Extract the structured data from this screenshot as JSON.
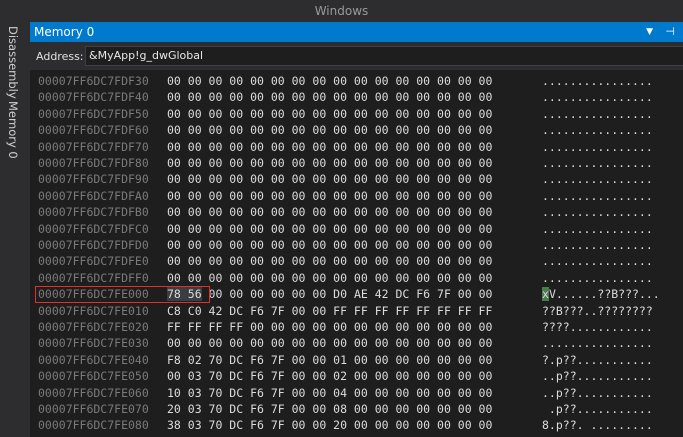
{
  "window": {
    "title": "Windows"
  },
  "rail": {
    "disassembly_tab": "Disassembly",
    "memory_tab": "Memory 0"
  },
  "panel": {
    "title": "Memory 0"
  },
  "address": {
    "label": "Address:",
    "value": "&MyApp!g_dwGlobal"
  },
  "colors": {
    "accent": "#007acc",
    "highlight": "#e0302a"
  },
  "rows": [
    {
      "addr": "00007FF6DC7FDF30",
      "bytes": "00 00 00 00 00 00 00 00 00 00 00 00 00 00 00 00",
      "ascii": "................"
    },
    {
      "addr": "00007FF6DC7FDF40",
      "bytes": "00 00 00 00 00 00 00 00 00 00 00 00 00 00 00 00",
      "ascii": "................"
    },
    {
      "addr": "00007FF6DC7FDF50",
      "bytes": "00 00 00 00 00 00 00 00 00 00 00 00 00 00 00 00",
      "ascii": "................"
    },
    {
      "addr": "00007FF6DC7FDF60",
      "bytes": "00 00 00 00 00 00 00 00 00 00 00 00 00 00 00 00",
      "ascii": "................"
    },
    {
      "addr": "00007FF6DC7FDF70",
      "bytes": "00 00 00 00 00 00 00 00 00 00 00 00 00 00 00 00",
      "ascii": "................"
    },
    {
      "addr": "00007FF6DC7FDF80",
      "bytes": "00 00 00 00 00 00 00 00 00 00 00 00 00 00 00 00",
      "ascii": "................"
    },
    {
      "addr": "00007FF6DC7FDF90",
      "bytes": "00 00 00 00 00 00 00 00 00 00 00 00 00 00 00 00",
      "ascii": "................"
    },
    {
      "addr": "00007FF6DC7FDFA0",
      "bytes": "00 00 00 00 00 00 00 00 00 00 00 00 00 00 00 00",
      "ascii": "................"
    },
    {
      "addr": "00007FF6DC7FDFB0",
      "bytes": "00 00 00 00 00 00 00 00 00 00 00 00 00 00 00 00",
      "ascii": "................"
    },
    {
      "addr": "00007FF6DC7FDFC0",
      "bytes": "00 00 00 00 00 00 00 00 00 00 00 00 00 00 00 00",
      "ascii": "................"
    },
    {
      "addr": "00007FF6DC7FDFD0",
      "bytes": "00 00 00 00 00 00 00 00 00 00 00 00 00 00 00 00",
      "ascii": "................"
    },
    {
      "addr": "00007FF6DC7FDFE0",
      "bytes": "00 00 00 00 00 00 00 00 00 00 00 00 00 00 00 00",
      "ascii": "................"
    },
    {
      "addr": "00007FF6DC7FDFF0",
      "bytes": "00 00 00 00 00 00 00 00 00 00 00 00 00 00 00 00",
      "ascii": "................"
    },
    {
      "addr": "00007FF6DC7FE000",
      "bytes_sel": "78 56",
      "bytes": "00 00 00 00 00 00 D0 AE 42 DC F6 7F 00 00",
      "ascii_sel": "x",
      "ascii": "V......??B???..."
    },
    {
      "addr": "00007FF6DC7FE010",
      "bytes": "C8 C0 42 DC F6 7F 00 00 FF FF FF FF FF FF FF FF",
      "ascii": "??B???..????????"
    },
    {
      "addr": "00007FF6DC7FE020",
      "bytes": "FF FF FF FF 00 00 00 00 00 00 00 00 00 00 00 00",
      "ascii": "????............"
    },
    {
      "addr": "00007FF6DC7FE030",
      "bytes": "00 00 00 00 00 00 00 00 00 00 00 00 00 00 00 00",
      "ascii": "................"
    },
    {
      "addr": "00007FF6DC7FE040",
      "bytes": "F8 02 70 DC F6 7F 00 00 01 00 00 00 00 00 00 00",
      "ascii": "?.p??..........."
    },
    {
      "addr": "00007FF6DC7FE050",
      "bytes": "00 03 70 DC F6 7F 00 00 02 00 00 00 00 00 00 00",
      "ascii": "..p??..........."
    },
    {
      "addr": "00007FF6DC7FE060",
      "bytes": "10 03 70 DC F6 7F 00 00 04 00 00 00 00 00 00 00",
      "ascii": "..p??..........."
    },
    {
      "addr": "00007FF6DC7FE070",
      "bytes": "20 03 70 DC F6 7F 00 00 08 00 00 00 00 00 00 00",
      "ascii": " .p??..........."
    },
    {
      "addr": "00007FF6DC7FE080",
      "bytes": "38 03 70 DC F6 7F 00 00 20 00 00 00 00 00 00 00",
      "ascii": "8.p??. ........."
    }
  ]
}
